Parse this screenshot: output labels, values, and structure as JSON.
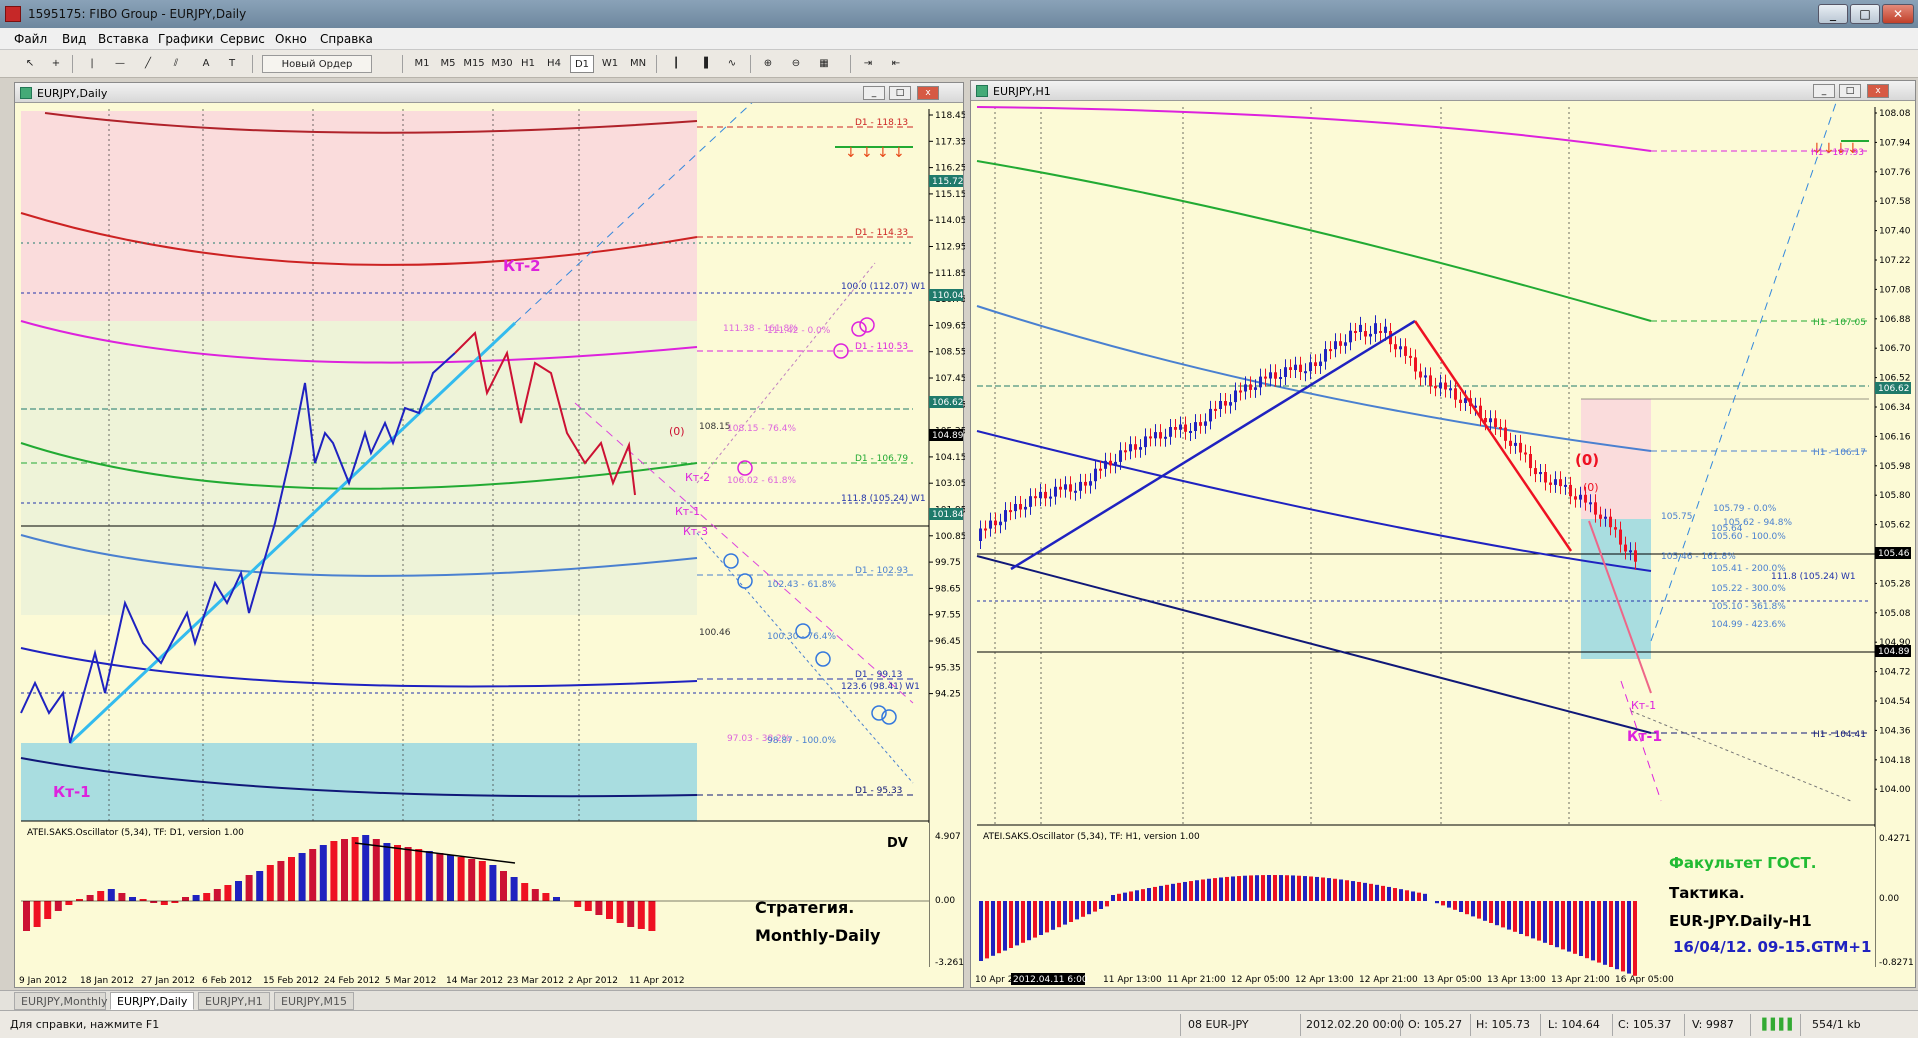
{
  "app": {
    "title": "1595175: FIBO Group - EURJPY,Daily",
    "minimize": "_",
    "maximize": "□",
    "close": "✕"
  },
  "menu": [
    "Файл",
    "Вид",
    "Вставка",
    "Графики",
    "Сервис",
    "Окно",
    "Справка"
  ],
  "toolbar": {
    "new_order": "Новый Ордер",
    "timeframes": [
      "M1",
      "M5",
      "M15",
      "M30",
      "H1",
      "H4",
      "D1",
      "W1",
      "MN"
    ],
    "active_timeframe": "D1",
    "icons": [
      "cursor-icon",
      "crosshair-icon",
      "vertical-line-icon",
      "horizontal-line-icon",
      "trendline-icon",
      "channel-icon",
      "text-icon",
      "text-label-icon"
    ]
  },
  "left_chart": {
    "title": "EURJPY,Daily",
    "price_axis": [
      "118.45",
      "117.35",
      "116.25",
      "115.15",
      "114.05",
      "112.95",
      "111.85",
      "110.75",
      "109.65",
      "108.55",
      "107.45",
      "106.35",
      "105.25",
      "104.15",
      "103.05",
      "101.95",
      "100.85",
      "99.75",
      "98.65",
      "97.55",
      "96.45",
      "95.35",
      "94.25"
    ],
    "price_tags": [
      {
        "value": "115.72",
        "color": "#1f7a6b"
      },
      {
        "value": "110.04",
        "color": "#1f7a6b"
      },
      {
        "value": "106.62",
        "color": "#1f7a6b"
      },
      {
        "value": "104.89",
        "color": "#000000"
      },
      {
        "value": "101.84",
        "color": "#1f7a6b"
      }
    ],
    "date_axis": [
      "9 Jan 2012",
      "18 Jan 2012",
      "27 Jan 2012",
      "6 Feb 2012",
      "15 Feb 2012",
      "24 Feb 2012",
      "5 Mar 2012",
      "14 Mar 2012",
      "23 Mar 2012",
      "2 Apr 2012",
      "11 Apr 2012"
    ],
    "level_labels": [
      "D1 - 118.13",
      "D1 - 114.33",
      "100.0 (112.07) W1",
      "111.38 - 161.8%",
      "111.42 - 0.0%",
      "D1 - 110.53",
      "108.15",
      "108.15 - 76.4%",
      "D1 - 106.79",
      "106.02 - 61.8%",
      "111.8 (105.24) W1",
      "D1 - 102.93",
      "102.43 - 61.8%",
      "100.46",
      "100.30 - 76.4%",
      "D1 - 99.13",
      "123.6 (98.41) W1",
      "97.03 - 38.2%",
      "98.87 - 100.0%",
      "D1 - 95.33"
    ],
    "annotations": {
      "kt2": "Кт-2",
      "kt1": "Кт-1",
      "zero": "(0)",
      "kt2_small": "Кт-2",
      "kt1_small": "Кт-1",
      "kt3_small": "Кт-3"
    },
    "oscillator": {
      "label": "ATEI.SAKS.Oscillator (5,34), TF: D1, version 1.00",
      "corner": "DV",
      "axis": [
        "4.907",
        "0.00",
        "-3.261"
      ],
      "text_line1": "Стратегия.",
      "text_line2": "Monthly-Daily"
    }
  },
  "right_chart": {
    "title": "EURJPY,H1",
    "price_axis": [
      "108.08",
      "107.94",
      "107.76",
      "107.58",
      "107.40",
      "107.22",
      "107.08",
      "106.88",
      "106.70",
      "106.52",
      "106.34",
      "106.16",
      "105.98",
      "105.80",
      "105.62",
      "105.46",
      "105.28",
      "105.08",
      "104.90",
      "104.72",
      "104.54",
      "104.36",
      "104.18",
      "104.00"
    ],
    "price_tags": [
      {
        "value": "106.62",
        "color": "#1f7a6b"
      },
      {
        "value": "105.46",
        "color": "#000000"
      },
      {
        "value": "104.89",
        "color": "#000000"
      }
    ],
    "date_axis": [
      "10 Apr 2012",
      "2012.04.11 6:00",
      "11 Apr 13:00",
      "11 Apr 21:00",
      "12 Apr 05:00",
      "12 Apr 13:00",
      "12 Apr 21:00",
      "13 Apr 05:00",
      "13 Apr 13:00",
      "13 Apr 21:00",
      "16 Apr 05:00"
    ],
    "level_labels": [
      "H1 - 107.93",
      "H1 - 107.05",
      "H1 - 106.17",
      "105.79 - 0.0%",
      "105.75",
      "105.62 - 94.8%",
      "105.64",
      "105.60 - 100.0%",
      "105.46 - 161.8%",
      "105.41 - 200.0%",
      "105.22 - 300.0%",
      "105.10 - 361.8%",
      "104.99 - 423.6%",
      "111.8 (105.24) W1",
      "H1 - 104.41"
    ],
    "annotations": {
      "zero_big": "(0)",
      "zero_small": "(0)",
      "kt1_small": "Кт-1",
      "kt1": "Кт-1"
    },
    "oscillator": {
      "label": "ATEI.SAKS.Oscillator (5,34), TF: H1, version 1.00",
      "axis": [
        "0.4271",
        "0.00",
        "-0.8271"
      ],
      "text_line1": "Факультет ГОСТ.",
      "text_line2": "Тактика.",
      "text_line3": "EUR-JPY.Daily-H1",
      "text_line4": "16/04/12. 09-15.GTM+1"
    }
  },
  "tabs": [
    "EURJPY,Monthly",
    "EURJPY,Daily",
    "EURJPY,H1",
    "EURJPY,M15"
  ],
  "active_tab": "EURJPY,Daily",
  "status": {
    "help": "Для справки, нажмите F1",
    "profile": "08 EUR-JPY",
    "datetime": "2012.02.20 00:00",
    "open": "O: 105.27",
    "high": "H: 105.73",
    "low": "L: 104.64",
    "close": "C: 105.37",
    "volume": "V: 9987",
    "traffic": "554/1 kb"
  }
}
